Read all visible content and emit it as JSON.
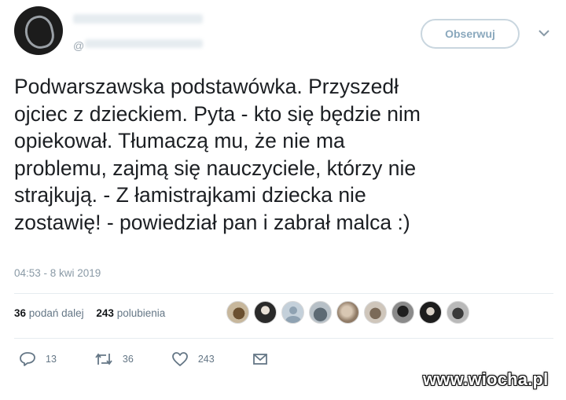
{
  "header": {
    "follow_label": "Obserwuj",
    "handle_glyph": "@"
  },
  "tweet": {
    "text_lines": [
      "Podwarszawska podstawówka. Przyszedł",
      "ojciec z dzieckiem. Pyta - kto się będzie nim",
      "opiekował. Tłumaczą mu, że nie ma",
      "problemu, zajmą się nauczyciele, którzy nie",
      "strajkują. - Z łamistrajkami dziecka nie",
      "zostawię! - powiedział pan i zabrał malca :)"
    ],
    "timestamp": "04:53 - 8 kwi 2019"
  },
  "stats": {
    "retweets_count": "36",
    "retweets_label": "podań dalej",
    "likes_count": "243",
    "likes_label": "polubienia"
  },
  "actions": {
    "reply_count": "13",
    "retweet_count": "36",
    "like_count": "243"
  },
  "icons": [
    "avatar",
    "chevron-down-icon",
    "reply-icon",
    "retweet-icon",
    "heart-icon",
    "mail-icon"
  ],
  "watermark": "www.wiocha.pl",
  "colors": {
    "follow_border": "#c9d6df",
    "follow_text": "#8aa8bd",
    "meta_text": "#657786",
    "divider": "#e6ecf0"
  }
}
